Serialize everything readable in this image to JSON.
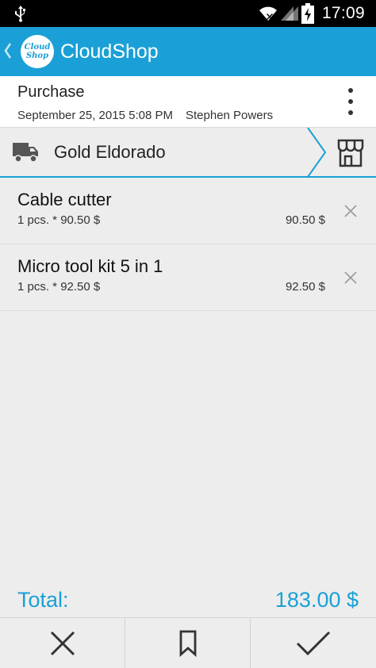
{
  "status_bar": {
    "time": "17:09"
  },
  "app": {
    "title": "CloudShop",
    "logo_line1": "Cloud",
    "logo_line2": "Shop"
  },
  "document": {
    "type": "Purchase",
    "date": "September 25, 2015 5:08 PM",
    "user": "Stephen Powers"
  },
  "supplier": {
    "name": "Gold Eldorado"
  },
  "items": [
    {
      "name": "Cable cutter",
      "qty_price": "1 pcs. * 90.50 $",
      "total": "90.50 $"
    },
    {
      "name": "Micro tool kit 5 in 1",
      "qty_price": "1 pcs. * 92.50 $",
      "total": "92.50 $"
    }
  ],
  "total": {
    "label": "Total:",
    "value": "183.00 $"
  },
  "colors": {
    "accent": "#1aa0d6",
    "statusbar": "#000000",
    "background": "#ededed"
  },
  "icons": {
    "back": "chevron-left-icon",
    "more": "more-vert-icon",
    "supplier": "truck-icon",
    "store": "store-icon",
    "remove": "close-icon",
    "cancel": "close-icon",
    "save": "bookmark-icon",
    "confirm": "check-icon"
  }
}
